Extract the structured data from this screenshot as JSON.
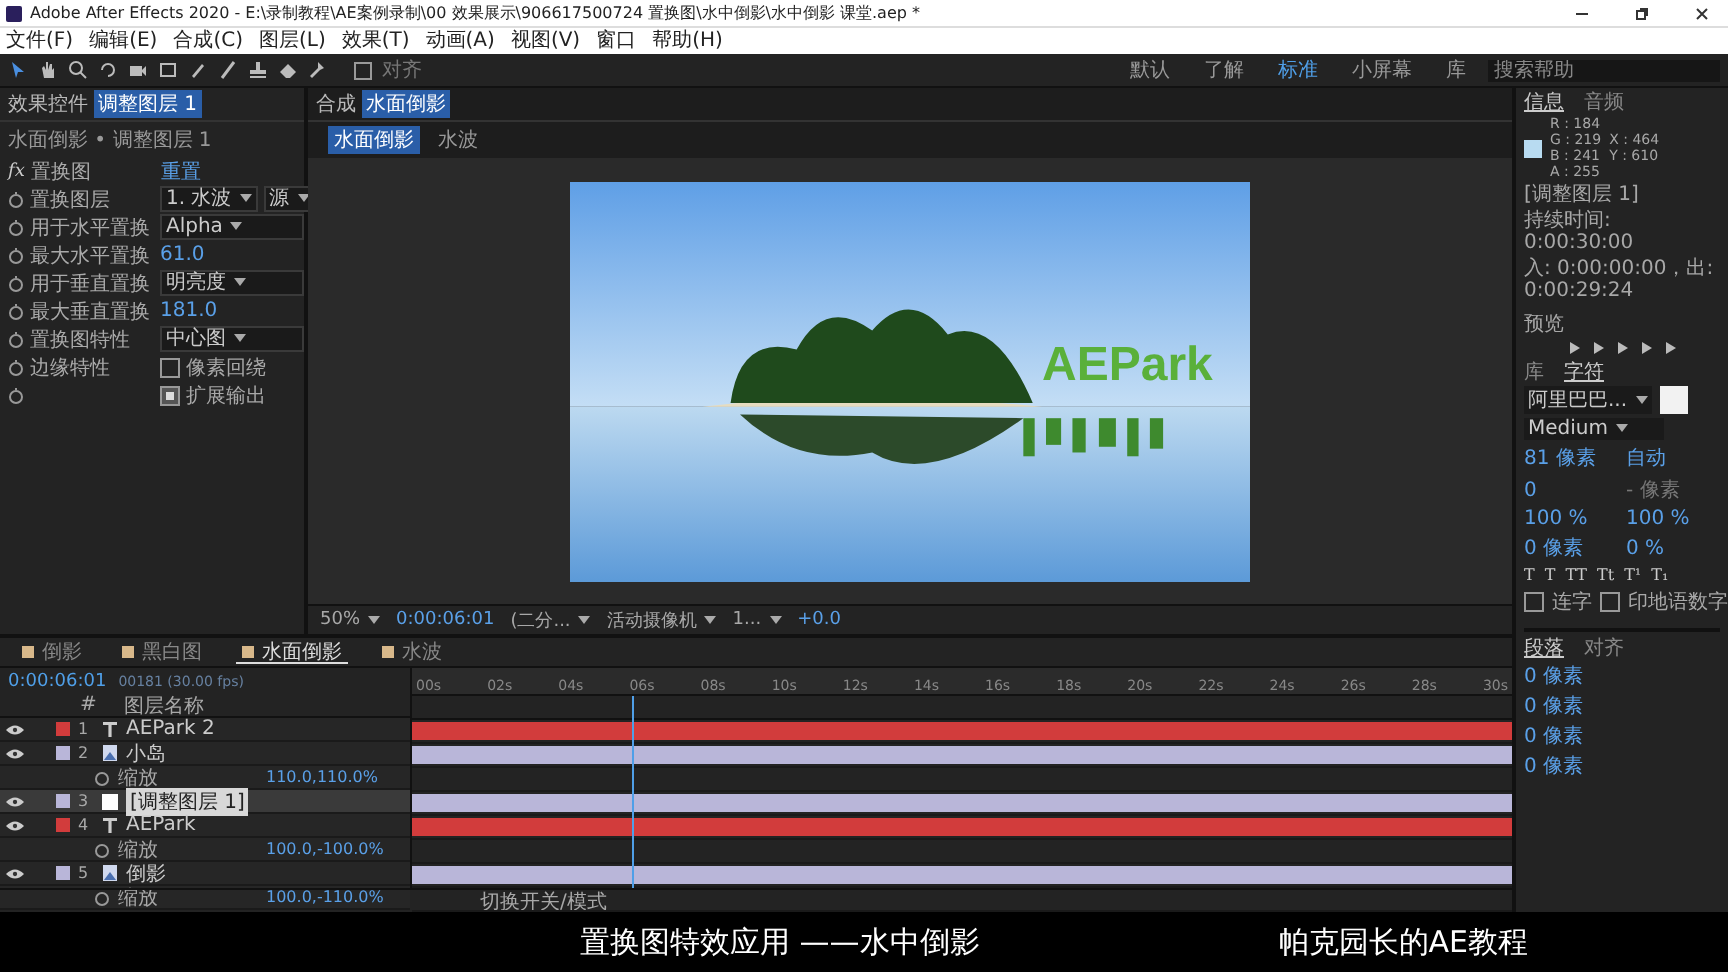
{
  "window": {
    "title": "Adobe After Effects 2020 - E:\\录制教程\\AE案例录制\\00 效果展示\\906617500724 置换图\\水中倒影\\水中倒影 课堂.aep *"
  },
  "menu": [
    "文件(F)",
    "编辑(E)",
    "合成(C)",
    "图层(L)",
    "效果(T)",
    "动画(A)",
    "视图(V)",
    "窗口",
    "帮助(H)"
  ],
  "toolbar": {
    "align_label": "对齐",
    "align_checked": false,
    "workspaces": [
      {
        "label": "默认",
        "selected": false
      },
      {
        "label": "了解",
        "selected": false
      },
      {
        "label": "标准",
        "selected": true
      },
      {
        "label": "小屏幕",
        "selected": false
      },
      {
        "label": "库",
        "selected": false
      }
    ],
    "search": {
      "placeholder": "搜索帮助"
    }
  },
  "effect_controls": {
    "tab_prefix": "效果控件",
    "tab_layer": "调整图层 1",
    "breadcrumb": "水面倒影 • 调整图层 1",
    "effect": {
      "fx_label": "fx",
      "name": "置换图",
      "reset": "重置"
    },
    "rows": [
      {
        "kind": "dropdown2",
        "label": "置换图层",
        "value": "1. 水波",
        "value2": "源"
      },
      {
        "kind": "dropdown",
        "label": "用于水平置换",
        "value": "Alpha"
      },
      {
        "kind": "number",
        "label": "最大水平置换",
        "value": "61.0"
      },
      {
        "kind": "dropdown",
        "label": "用于垂直置换",
        "value": "明亮度"
      },
      {
        "kind": "number",
        "label": "最大垂直置换",
        "value": "181.0"
      },
      {
        "kind": "dropdown",
        "label": "置换图特性",
        "value": "中心图"
      },
      {
        "kind": "checkbox",
        "label": "边缘特性",
        "option": "像素回绕",
        "checked": false
      },
      {
        "kind": "checkbox",
        "option": "扩展输出",
        "checked": true
      }
    ]
  },
  "composition": {
    "tab_prefix": "合成",
    "tab_name": "水面倒影",
    "subtabs": [
      {
        "label": "水面倒影",
        "selected": true
      },
      {
        "label": "水波",
        "selected": false
      }
    ],
    "title_text": "AEPark",
    "viewer_bar": {
      "zoom": "50%",
      "timecode": "0:00:06:01",
      "resolution": "(二分...",
      "camera": "活动摄像机",
      "views": "1...",
      "exposure": "+0.0"
    }
  },
  "info": {
    "tabs": [
      {
        "label": "信息",
        "selected": true
      },
      {
        "label": "音频",
        "selected": false
      }
    ],
    "rgba": [
      "R : 184",
      "G : 219",
      "B : 241",
      "A : 255"
    ],
    "xy": [
      "X : 464",
      "Y : 610"
    ],
    "layer": "[调整图层 1]",
    "duration": "持续时间: 0:00:30:00",
    "in_out": "入: 0:00:00:00，出: 0:00:29:24"
  },
  "preview": {
    "title": "预览"
  },
  "character": {
    "tabs": [
      {
        "label": "库",
        "selected": false
      },
      {
        "label": "字符",
        "selected": true
      }
    ],
    "font": "阿里巴巴...",
    "style": "Medium",
    "size": "81 像素",
    "leading": "自动",
    "kerning": "0",
    "stroke": "- 像素",
    "vscale": "100 %",
    "hscale": "100 %",
    "baseline": "0 像素",
    "tsume": "0 %",
    "styles": [
      "T",
      "T",
      "TT",
      "Tt",
      "T¹",
      "T₁"
    ],
    "ligatures": {
      "label": "连字",
      "checked": false
    },
    "hindi": {
      "label": "印地语数字",
      "checked": false
    }
  },
  "paragraph": {
    "tabs": [
      {
        "label": "段落",
        "selected": true
      },
      {
        "label": "对齐",
        "selected": false
      }
    ],
    "indents": [
      "0 像素",
      "0 像素",
      "0 像素",
      "0 像素"
    ]
  },
  "timeline": {
    "tabs": [
      {
        "label": "倒影",
        "selected": false
      },
      {
        "label": "黑白图",
        "selected": false
      },
      {
        "label": "水面倒影",
        "selected": true
      },
      {
        "label": "水波",
        "selected": false
      }
    ],
    "timecode": "0:00:06:01",
    "frame_info": "00181 (30.00 fps)",
    "column_number": "#",
    "column_name": "图层名称",
    "rows": [
      {
        "kind": "text_layer",
        "number": "1",
        "name": "AEPark 2",
        "color": "#d23c3c",
        "selected": false
      },
      {
        "kind": "image_layer",
        "number": "2",
        "name": "小岛",
        "color": "#b9b6d9",
        "selected": false
      },
      {
        "kind": "property",
        "name": "缩放",
        "value": "110.0,110.0%"
      },
      {
        "kind": "adjustment_layer",
        "number": "3",
        "name": "[调整图层 1]",
        "color": "#b9b6d9",
        "selected": true
      },
      {
        "kind": "text_layer",
        "number": "4",
        "name": "AEPark",
        "color": "#d23c3c",
        "selected": false
      },
      {
        "kind": "property",
        "name": "缩放",
        "value": "100.0,-100.0%"
      },
      {
        "kind": "image_layer",
        "number": "5",
        "name": "倒影",
        "color": "#b9b6d9",
        "selected": false
      },
      {
        "kind": "property",
        "name": "缩放",
        "value": "100.0,-110.0%"
      }
    ],
    "ruler": [
      "00s",
      "02s",
      "04s",
      "06s",
      "08s",
      "10s",
      "12s",
      "14s",
      "16s",
      "18s",
      "20s",
      "22s",
      "24s",
      "26s",
      "28s",
      "30s"
    ],
    "playhead": {
      "level": 0.2
    },
    "bottom_label": "切换开关/模式"
  },
  "subtitle": {
    "left": "置换图特效应用 ——水中倒影",
    "right": "帕克园长的AE教程"
  }
}
